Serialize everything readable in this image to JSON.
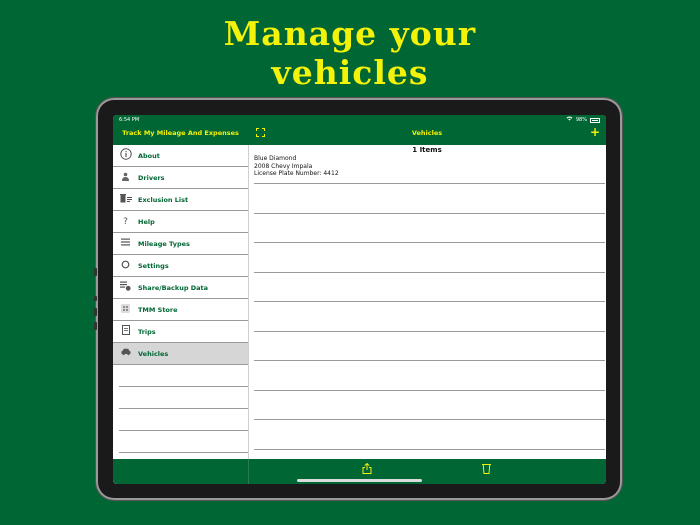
{
  "headline": {
    "line1": "Manage your",
    "line2": "vehicles"
  },
  "status_bar": {
    "time": "6:54 PM",
    "battery": "98%"
  },
  "sidebar": {
    "title": "Track My Mileage And Expenses",
    "items": [
      {
        "label": "About",
        "icon": "info-icon"
      },
      {
        "label": "Drivers",
        "icon": "person-icon"
      },
      {
        "label": "Exclusion List",
        "icon": "trash-list-icon"
      },
      {
        "label": "Help",
        "icon": "question-icon"
      },
      {
        "label": "Mileage Types",
        "icon": "list-icon"
      },
      {
        "label": "Settings",
        "icon": "circle-icon"
      },
      {
        "label": "Share/Backup Data",
        "icon": "share-data-icon"
      },
      {
        "label": "TMM Store",
        "icon": "grid-icon"
      },
      {
        "label": "Trips",
        "icon": "document-icon"
      },
      {
        "label": "Vehicles",
        "icon": "car-icon",
        "selected": true
      }
    ]
  },
  "main": {
    "title": "Vehicles",
    "count": "1 Items",
    "vehicles": [
      {
        "name": "Blue Diamond",
        "model": "2008 Chevy Impala",
        "plate": "License Plate Number: 4412"
      }
    ]
  },
  "colors": {
    "brand_green": "#006633",
    "accent_yellow": "#f2f20a",
    "selected_row": "#d6d6d6"
  }
}
